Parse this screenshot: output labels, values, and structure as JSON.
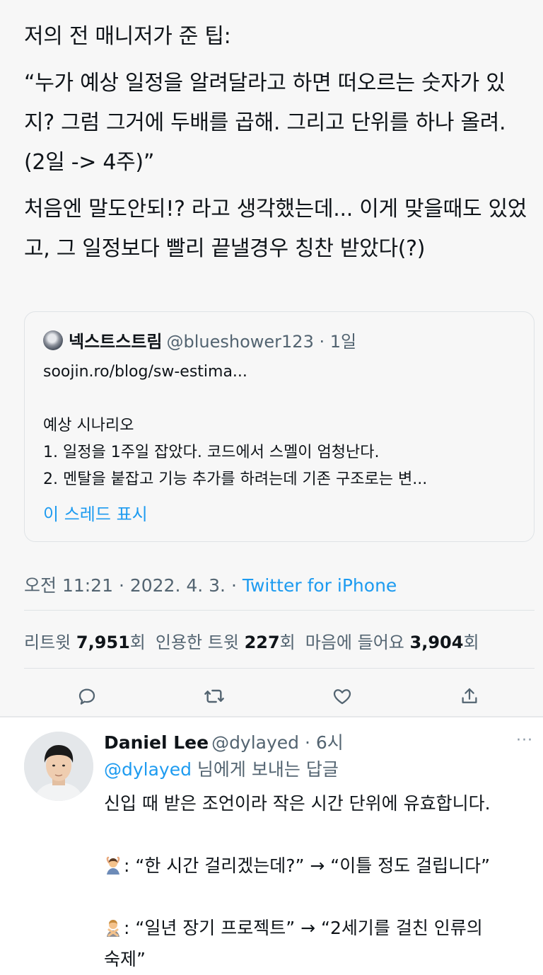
{
  "tweet": {
    "paragraphs": [
      "저의 전 매니저가 준 팁:",
      "“누가 예상 일정을 알려달라고 하면 떠오르는 숫자가 있지? 그럼 그거에 두배를 곱해. 그리고 단위를 하나 올려. (2일 -> 4주)”",
      "처음엔 말도안되!? 라고 생각했는데... 이게 맞을때도 있었고, 그 일정보다 빨리 끝낼경우 칭찬 받았다(?)"
    ]
  },
  "quote": {
    "author_name": "넥스트스트림",
    "handle_time": "@blueshower123 · 1일",
    "lines": [
      "soojin.ro/blog/sw-estima...",
      "",
      "예상 시나리오",
      "1. 일정을 1주일 잡았다. 코드에서 스멜이 엄청난다.",
      "2. 멘탈을 붙잡고 기능 추가를 하려는데 기존 구조로는 변..."
    ],
    "show_thread": "이 스레드 표시"
  },
  "meta": {
    "time": "오전 11:21 · 2022. 4. 3. · ",
    "source": "Twitter for iPhone"
  },
  "stats": {
    "retweet_label": "리트윗 ",
    "retweet_count": "7,951",
    "retweet_unit": "회",
    "quote_label": "인용한 트윗 ",
    "quote_count": "227",
    "quote_unit": "회",
    "like_label": "마음에 들어요 ",
    "like_count": "3,904",
    "like_unit": "회"
  },
  "actions": {
    "icons": [
      "reply-icon",
      "retweet-icon",
      "like-icon",
      "share-icon"
    ],
    "color": "#536471"
  },
  "reply": {
    "author_name": "Daniel Lee",
    "handle_time": "@dylayed · 6시",
    "more": "···",
    "replying_at": "@dylayed",
    "replying_suffix": " 님에게 보내는 답글",
    "line1": "신입 때 받은 조언이라 작은 시간 단위에 유효합니다.",
    "line2": ": “한 시간 걸리겠는데?” → “이틀 정도 걸립니다”",
    "line3": ": “일년 장기 프로젝트” → “2세기를 걸친 인류의",
    "line4": "숙제”",
    "emoji1": "person-gesturing-ok-emoji",
    "emoji2": "person-gesturing-no-emoji"
  },
  "colors": {
    "accent": "#1d9bf0",
    "secondary_text": "#536471",
    "main_bg": "#f7f7f7"
  }
}
